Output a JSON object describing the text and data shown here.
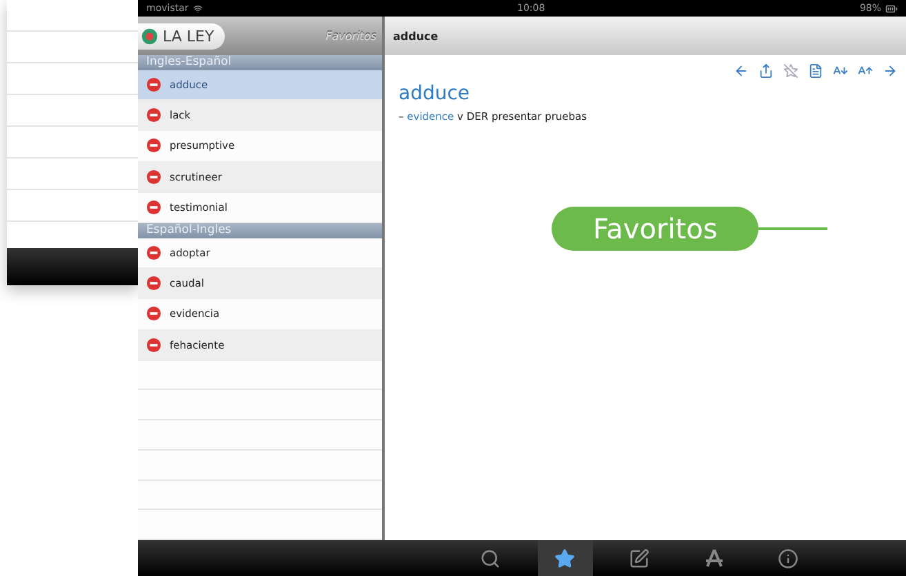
{
  "status_bar": {
    "carrier": "movistar",
    "time": "10:08",
    "battery": "98%"
  },
  "nav": {
    "logo": "LA LEY",
    "back_title": "Favoritos",
    "title": "adduce"
  },
  "sections": [
    {
      "title": "Ingles-Español",
      "items": [
        {
          "word": "adduce",
          "selected": true
        },
        {
          "word": "lack",
          "selected": false
        },
        {
          "word": "presumptive",
          "selected": false
        },
        {
          "word": "scrutineer",
          "selected": false
        },
        {
          "word": "testimonial",
          "selected": false
        }
      ]
    },
    {
      "title": "Español-Ingles",
      "items": [
        {
          "word": "adoptar",
          "selected": false
        },
        {
          "word": "caudal",
          "selected": false
        },
        {
          "word": "evidencia",
          "selected": false
        },
        {
          "word": "fehaciente",
          "selected": false
        }
      ]
    }
  ],
  "entry": {
    "headword": "adduce",
    "senses": [
      {
        "bullet": "–",
        "term": "evidence",
        "pos": "v",
        "field": "DER",
        "translation": "presentar pruebas"
      }
    ]
  },
  "tab_bar": [
    {
      "kind": "search",
      "selected": false
    },
    {
      "kind": "favorites",
      "selected": true
    },
    {
      "kind": "notes",
      "selected": false
    },
    {
      "kind": "apps",
      "selected": false
    },
    {
      "kind": "info",
      "selected": false
    }
  ],
  "callout": {
    "label": "Favoritos"
  }
}
